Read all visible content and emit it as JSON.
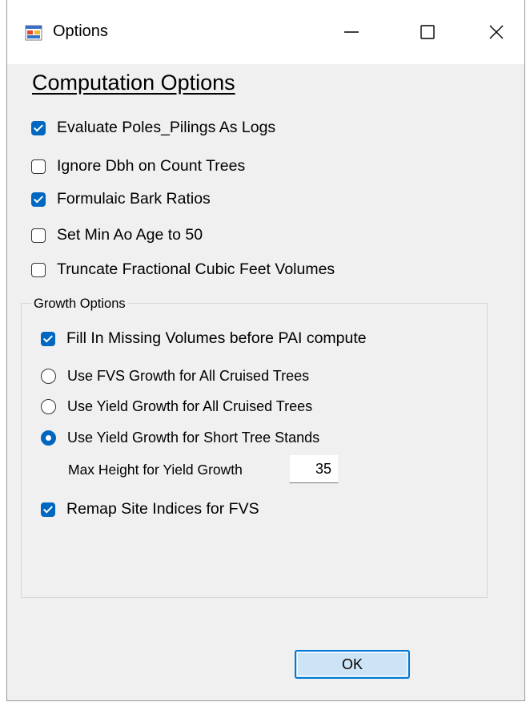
{
  "window": {
    "title": "Options",
    "app_icon": "windows-form-icon",
    "controls": {
      "minimize_icon": "minimize-icon",
      "maximize_icon": "maximize-icon",
      "close_icon": "close-icon"
    }
  },
  "computation": {
    "heading": "Computation Options",
    "options": [
      {
        "label": "Evaluate Poles_Pilings As Logs",
        "checked": true
      },
      {
        "label": "Ignore Dbh on Count Trees",
        "checked": false
      },
      {
        "label": "Formulaic Bark Ratios",
        "checked": true
      },
      {
        "label": "Set Min Ao Age to 50",
        "checked": false
      },
      {
        "label": "Truncate Fractional Cubic Feet Volumes",
        "checked": false
      }
    ]
  },
  "growth": {
    "legend": "Growth Options",
    "fill_missing": {
      "label": "Fill In Missing Volumes before PAI compute",
      "checked": true
    },
    "radios": [
      {
        "label": "Use FVS Growth for All Cruised Trees",
        "selected": false
      },
      {
        "label": "Use Yield Growth for All Cruised Trees",
        "selected": false
      },
      {
        "label": "Use Yield Growth for Short Tree Stands",
        "selected": true
      }
    ],
    "max_height_label": "Max Height for Yield Growth",
    "max_height_value": "35",
    "remap": {
      "label": "Remap Site Indices for FVS",
      "checked": true
    }
  },
  "ok_label": "OK",
  "colors": {
    "accent": "#0067c0",
    "button_face": "#cde4f7",
    "dialog_bg": "#f0f0f0"
  }
}
